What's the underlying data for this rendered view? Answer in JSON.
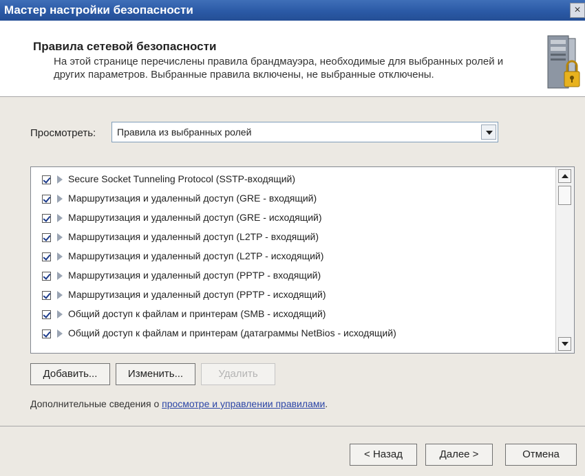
{
  "window": {
    "title": "Мастер настройки безопасности",
    "close_glyph": "×"
  },
  "header": {
    "title": "Правила сетевой безопасности",
    "description": "На этой странице перечислены правила брандмауэра, необходимые для выбранных ролей и других параметров. Выбранные правила включены, не выбранные отключены.",
    "icon": "server-lock-icon"
  },
  "view": {
    "label": "Просмотреть:",
    "selected": "Правила из выбранных ролей"
  },
  "rules": [
    {
      "label": "Secure Socket Tunneling Protocol (SSTP-входящий)",
      "checked": true
    },
    {
      "label": "Маршрутизация и удаленный доступ (GRE - входящий)",
      "checked": true
    },
    {
      "label": "Маршрутизация и удаленный доступ (GRE - исходящий)",
      "checked": true
    },
    {
      "label": "Маршрутизация и удаленный доступ (L2TP - входящий)",
      "checked": true
    },
    {
      "label": "Маршрутизация и удаленный доступ (L2TP - исходящий)",
      "checked": true
    },
    {
      "label": "Маршрутизация и удаленный доступ (PPTP - входящий)",
      "checked": true
    },
    {
      "label": "Маршрутизация и удаленный доступ (PPTP - исходящий)",
      "checked": true
    },
    {
      "label": "Общий доступ к файлам и принтерам (SMB - исходящий)",
      "checked": true
    },
    {
      "label": "Общий доступ к файлам и принтерам (датаграммы NetBios - исходящий)",
      "checked": true
    }
  ],
  "buttons": {
    "add": "Добавить...",
    "edit": "Изменить...",
    "delete": "Удалить"
  },
  "more_info": {
    "prefix": "Дополнительные сведения о ",
    "link": "просмотре и управлении правилами",
    "suffix": "."
  },
  "footer": {
    "back": "< Назад",
    "next": "Далее >",
    "cancel": "Отмена"
  },
  "colors": {
    "titlebar": "#2b5aa6",
    "link": "#2b45a6",
    "checkmark": "#1b3a8a"
  }
}
